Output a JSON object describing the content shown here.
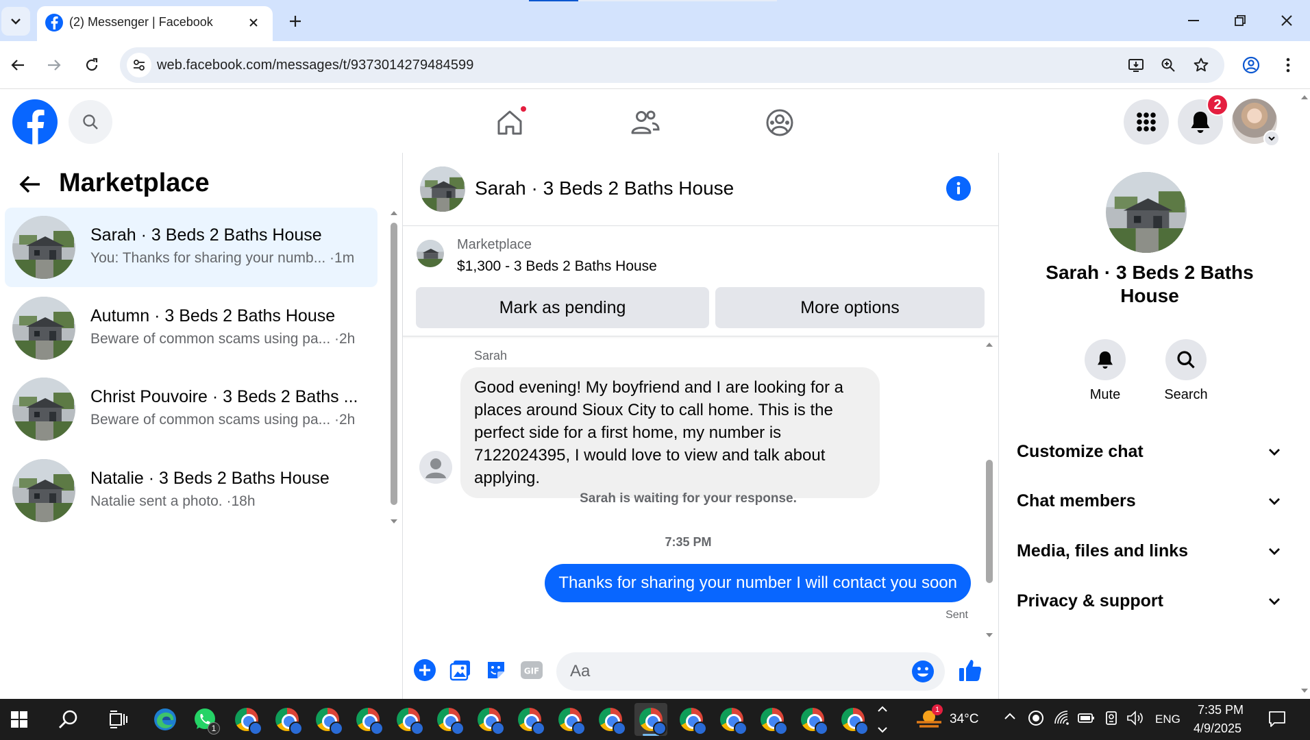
{
  "browser": {
    "tab_title": "(2) Messenger | Facebook",
    "url": "web.facebook.com/messages/t/9373014279484599"
  },
  "fb_header": {
    "notifications_count": "2"
  },
  "chat_list": {
    "title": "Marketplace",
    "items": [
      {
        "name": "Sarah · 3 Beds 2 Baths House",
        "preview": "You: Thanks for sharing your numb... ·1m",
        "active": true
      },
      {
        "name": "Autumn · 3 Beds 2 Baths House",
        "preview": "Beware of common scams using pa... ·2h",
        "active": false
      },
      {
        "name": "Christ Pouvoire · 3 Beds 2 Baths ...",
        "preview": "Beware of common scams using pa... ·2h",
        "active": false
      },
      {
        "name": "Natalie · 3 Beds 2 Baths House",
        "preview": "Natalie sent a photo. ·18h",
        "active": false
      }
    ]
  },
  "conversation": {
    "title": "Sarah · 3 Beds 2 Baths House",
    "listing_label": "Marketplace",
    "listing_price_title": "$1,300 - 3 Beds 2 Baths House",
    "mark_pending_label": "Mark as pending",
    "more_options_label": "More options",
    "sender_name": "Sarah",
    "incoming_message": "Good evening! My boyfriend and I are looking for a places around Sioux City to call home. This is the perfect side for a first home, my number is 7122024395, I would love to view and talk about applying.",
    "waiting_text": "Sarah is waiting for your response.",
    "timestamp": "7:35 PM",
    "outgoing_message": "Thanks for sharing your number I will contact you soon",
    "sent_label": "Sent",
    "input_placeholder": "Aa"
  },
  "details_panel": {
    "title": "Sarah · 3 Beds 2 Baths House",
    "mute_label": "Mute",
    "search_label": "Search",
    "sections": [
      "Customize chat",
      "Chat members",
      "Media, files and links",
      "Privacy & support"
    ]
  },
  "taskbar": {
    "weather_temp": "34°C",
    "weather_badge": "1",
    "whatsapp_badge": "1",
    "language": "ENG",
    "time": "7:35 PM",
    "date": "4/9/2025"
  },
  "colors": {
    "messenger_blue": "#0866ff",
    "active_row_bg": "#ebf5ff",
    "badge_red": "#e41e3f"
  }
}
